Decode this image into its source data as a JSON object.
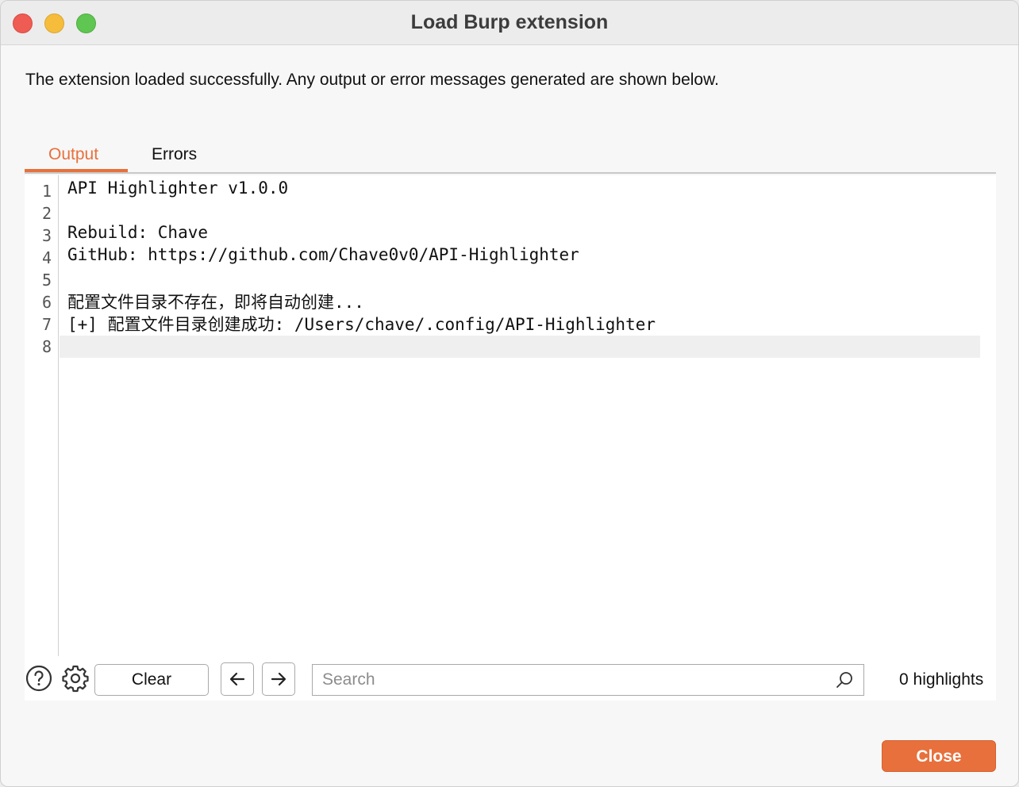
{
  "window": {
    "title": "Load Burp extension"
  },
  "message": "The extension loaded successfully. Any output or error messages generated are shown below.",
  "tabs": [
    {
      "label": "Output",
      "active": true
    },
    {
      "label": "Errors",
      "active": false
    }
  ],
  "editor": {
    "line_numbers": [
      "1",
      "2",
      "3",
      "4",
      "5",
      "6",
      "7",
      "8"
    ],
    "lines": [
      "API Highlighter v1.0.0",
      "",
      "Rebuild: Chave",
      "GitHub: https://github.com/Chave0v0/API-Highlighter",
      "",
      "配置文件目录不存在，即将自动创建...",
      "[+] 配置文件目录创建成功: /Users/chave/.config/API-Highlighter",
      ""
    ]
  },
  "toolbar": {
    "help_icon": "question-circle-icon",
    "settings_icon": "gear-icon",
    "clear_label": "Clear",
    "search_placeholder": "Search",
    "highlights_text": "0 highlights"
  },
  "footer": {
    "close_label": "Close"
  },
  "colors": {
    "accent": "#e8703c"
  }
}
